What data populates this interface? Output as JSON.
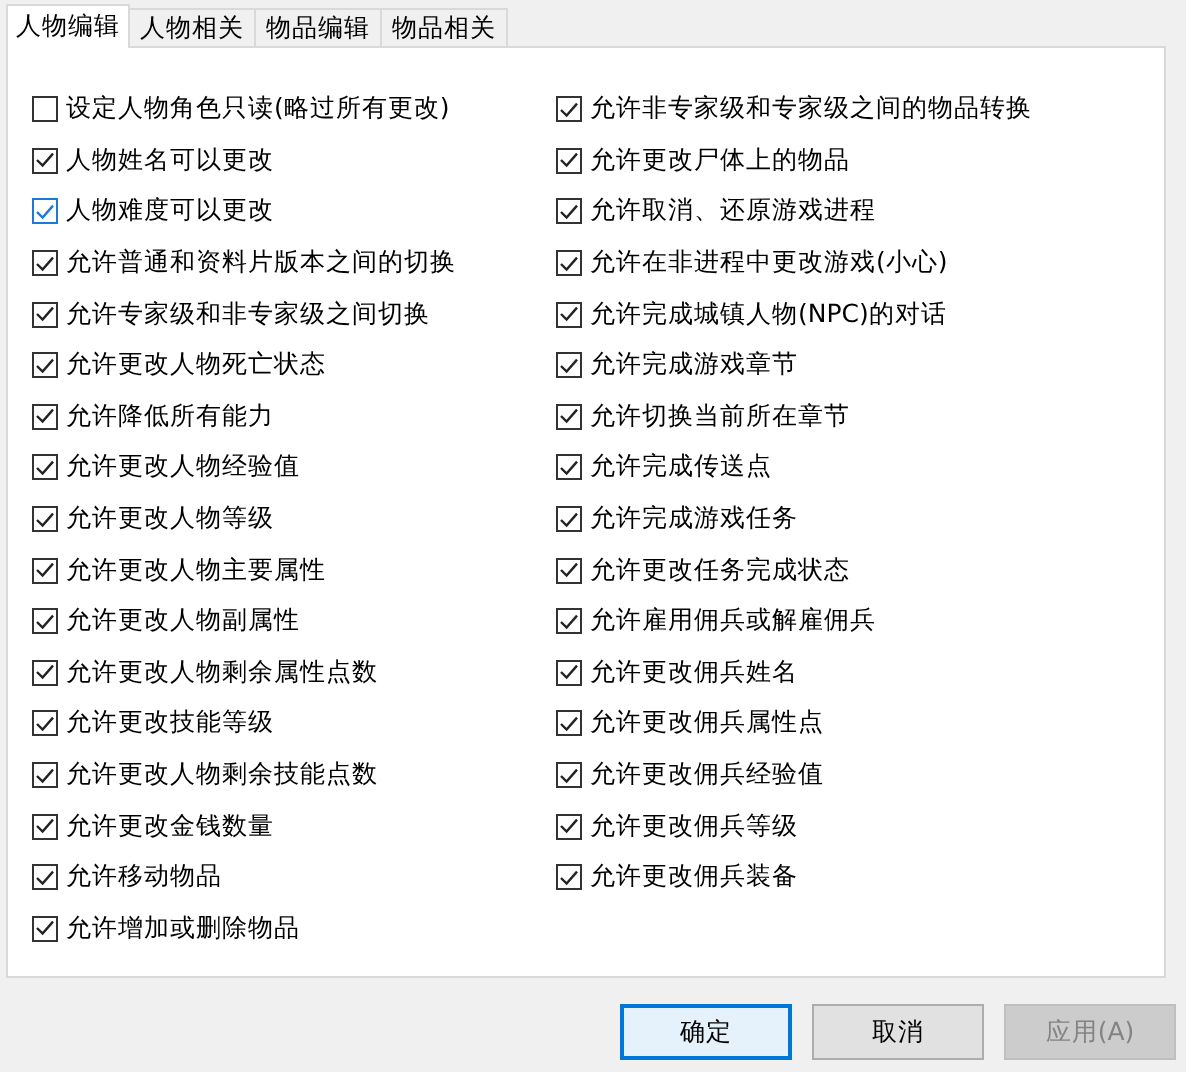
{
  "tabs": [
    {
      "label": "人物编辑",
      "selected": true
    },
    {
      "label": "人物相关",
      "selected": false
    },
    {
      "label": "物品编辑",
      "selected": false
    },
    {
      "label": "物品相关",
      "selected": false
    }
  ],
  "columns": [
    {
      "items": [
        {
          "label": "设定人物角色只读(略过所有更改)",
          "checked": false,
          "hovered": false
        },
        {
          "label": "人物姓名可以更改",
          "checked": true,
          "hovered": false
        },
        {
          "label": "人物难度可以更改",
          "checked": true,
          "hovered": true
        },
        {
          "label": "允许普通和资料片版本之间的切换",
          "checked": true,
          "hovered": false
        },
        {
          "label": "允许专家级和非专家级之间切换",
          "checked": true,
          "hovered": false
        },
        {
          "label": "允许更改人物死亡状态",
          "checked": true,
          "hovered": false
        },
        {
          "label": "允许降低所有能力",
          "checked": true,
          "hovered": false
        },
        {
          "label": "允许更改人物经验值",
          "checked": true,
          "hovered": false
        },
        {
          "label": "允许更改人物等级",
          "checked": true,
          "hovered": false
        },
        {
          "label": "允许更改人物主要属性",
          "checked": true,
          "hovered": false
        },
        {
          "label": "允许更改人物副属性",
          "checked": true,
          "hovered": false
        },
        {
          "label": "允许更改人物剩余属性点数",
          "checked": true,
          "hovered": false
        },
        {
          "label": "允许更改技能等级",
          "checked": true,
          "hovered": false
        },
        {
          "label": "允许更改人物剩余技能点数",
          "checked": true,
          "hovered": false
        },
        {
          "label": "允许更改金钱数量",
          "checked": true,
          "hovered": false
        },
        {
          "label": "允许移动物品",
          "checked": true,
          "hovered": false
        },
        {
          "label": "允许增加或删除物品",
          "checked": true,
          "hovered": false
        }
      ]
    },
    {
      "items": [
        {
          "label": "允许非专家级和专家级之间的物品转换",
          "checked": true,
          "hovered": false
        },
        {
          "label": "允许更改尸体上的物品",
          "checked": true,
          "hovered": false
        },
        {
          "label": "允许取消、还原游戏进程",
          "checked": true,
          "hovered": false
        },
        {
          "label": "允许在非进程中更改游戏(小心)",
          "checked": true,
          "hovered": false
        },
        {
          "label": "允许完成城镇人物(NPC)的对话",
          "checked": true,
          "hovered": false
        },
        {
          "label": "允许完成游戏章节",
          "checked": true,
          "hovered": false
        },
        {
          "label": "允许切换当前所在章节",
          "checked": true,
          "hovered": false
        },
        {
          "label": "允许完成传送点",
          "checked": true,
          "hovered": false
        },
        {
          "label": "允许完成游戏任务",
          "checked": true,
          "hovered": false
        },
        {
          "label": "允许更改任务完成状态",
          "checked": true,
          "hovered": false
        },
        {
          "label": "允许雇用佣兵或解雇佣兵",
          "checked": true,
          "hovered": false
        },
        {
          "label": "允许更改佣兵姓名",
          "checked": true,
          "hovered": false
        },
        {
          "label": "允许更改佣兵属性点",
          "checked": true,
          "hovered": false
        },
        {
          "label": "允许更改佣兵经验值",
          "checked": true,
          "hovered": false
        },
        {
          "label": "允许更改佣兵等级",
          "checked": true,
          "hovered": false
        },
        {
          "label": "允许更改佣兵装备",
          "checked": true,
          "hovered": false
        }
      ]
    }
  ],
  "buttons": [
    {
      "label": "确定",
      "focused": true,
      "disabled": false
    },
    {
      "label": "取消",
      "focused": false,
      "disabled": false
    },
    {
      "label": "应用(A)",
      "focused": false,
      "disabled": true
    }
  ]
}
